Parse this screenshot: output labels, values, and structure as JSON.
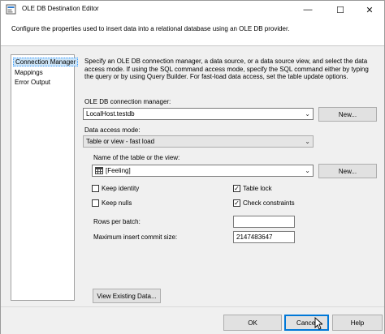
{
  "window": {
    "title": "OLE DB Destination Editor",
    "controls": {
      "minimize": "—",
      "maximize": "☐",
      "close": "✕"
    }
  },
  "description": "Configure the properties used to insert data into a relational database using an OLE DB provider.",
  "nav": {
    "items": [
      {
        "label": "Connection Manager",
        "selected": true
      },
      {
        "label": "Mappings",
        "selected": false
      },
      {
        "label": "Error Output",
        "selected": false
      }
    ]
  },
  "main": {
    "intro": "Specify an OLE DB connection manager, a data source, or a data source view, and select the data access mode. If using the SQL command access mode, specify the SQL command either by typing the query or by using Query Builder. For fast-load data access, set the table update options.",
    "connection_manager": {
      "label": "OLE DB connection manager:",
      "value": "LocalHost.testdb",
      "new_button": "New..."
    },
    "data_access_mode": {
      "label": "Data access mode:",
      "value": "Table or view - fast load"
    },
    "table": {
      "label": "Name of the table or the view:",
      "value": "[Feeling]",
      "new_button": "New..."
    },
    "options": {
      "keep_identity": {
        "label": "Keep identity",
        "checked": false
      },
      "table_lock": {
        "label": "Table lock",
        "checked": true
      },
      "keep_nulls": {
        "label": "Keep nulls",
        "checked": false
      },
      "check_constraints": {
        "label": "Check constraints",
        "checked": true
      }
    },
    "rows_per_batch": {
      "label": "Rows per batch:",
      "value": ""
    },
    "max_commit_size": {
      "label": "Maximum insert commit size:",
      "value": "2147483647"
    },
    "view_existing_button": "View Existing Data..."
  },
  "footer": {
    "ok": "OK",
    "cancel": "Cancel",
    "help": "Help"
  },
  "glyphs": {
    "dropdown": "⌄",
    "check": "✓"
  },
  "colors": {
    "selection": "#cce4f7",
    "focus_border": "#0078d7"
  }
}
